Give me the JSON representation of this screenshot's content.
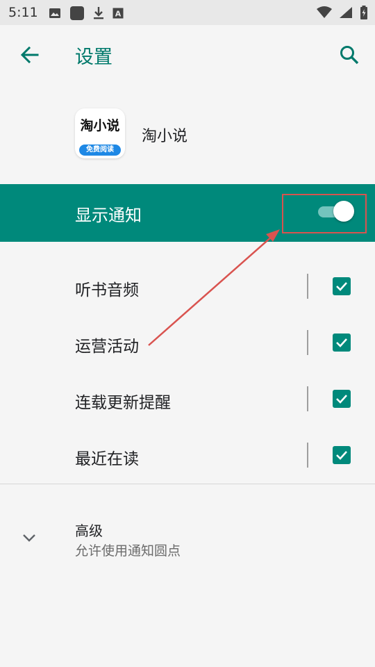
{
  "status_bar": {
    "time": "5:11",
    "left_icons": [
      "image-icon",
      "app-square-icon",
      "download-icon",
      "font-a-icon"
    ],
    "right_icons": [
      "wifi-icon",
      "signal-icon",
      "battery-icon"
    ]
  },
  "app_bar": {
    "title": "设置",
    "back_icon": "arrow-back-icon",
    "search_icon": "search-icon"
  },
  "app_info": {
    "logo_text": "淘小说",
    "logo_badge": "免费阅读",
    "name": "淘小说"
  },
  "main_toggle": {
    "label": "显示通知",
    "state": "on"
  },
  "channels": [
    {
      "label": "听书音频",
      "checked": true
    },
    {
      "label": "运营活动",
      "checked": true
    },
    {
      "label": "连载更新提醒",
      "checked": true
    },
    {
      "label": "最近在读",
      "checked": true
    }
  ],
  "advanced": {
    "title": "高级",
    "summary": "允许使用通知圆点",
    "icon": "chevron-down-icon"
  },
  "colors": {
    "accent": "#00897b",
    "title": "#00796b",
    "annotation": "#d9534f"
  }
}
